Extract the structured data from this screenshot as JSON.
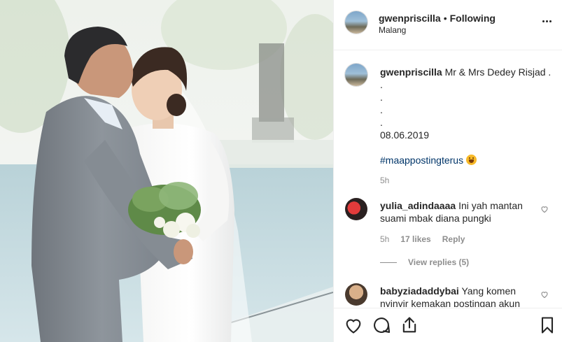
{
  "header": {
    "username": "gwenpriscilla",
    "separator": "•",
    "follow_status": "Following",
    "location": "Malang",
    "more_icon": "more-horizontal-icon"
  },
  "caption": {
    "username": "gwenpriscilla",
    "text": "Mr & Mrs Dedey Risjad .",
    "dots": [
      ".",
      ".",
      ".",
      "."
    ],
    "date": "08.06.2019",
    "hashtag": "#maappostingterus",
    "emoji": "face-with-tongue-emoji",
    "time": "5h"
  },
  "comments": [
    {
      "username": "yulia_adindaaaa",
      "text": "Ini yah mantan suami mbak diana pungki",
      "time": "5h",
      "likes": "17 likes",
      "reply_label": "Reply",
      "view_replies": "View replies (5)"
    },
    {
      "username": "babyziadaddybai",
      "text": "Yang komen nyinyir kemakan postingan akun"
    }
  ],
  "actions": {
    "like_icon": "heart-icon",
    "comment_icon": "comment-icon",
    "share_icon": "share-icon",
    "save_icon": "bookmark-icon"
  },
  "colors": {
    "hashtag": "#003569",
    "muted": "#8e8e8e",
    "text": "#262626",
    "border": "#efefef"
  }
}
